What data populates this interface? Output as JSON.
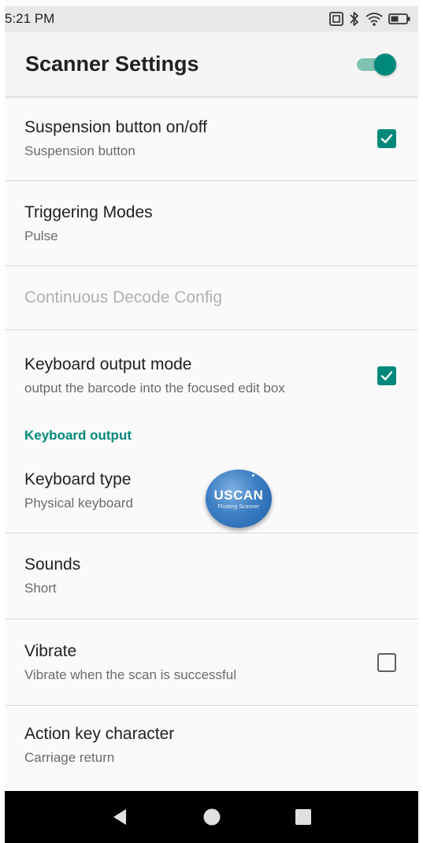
{
  "status_bar": {
    "time": "5:21 PM",
    "icons": [
      "nfc-icon",
      "bluetooth-icon",
      "wifi-icon",
      "battery-icon"
    ]
  },
  "app_bar": {
    "title": "Scanner Settings",
    "master_toggle_on": true,
    "accent_color": "#00897b"
  },
  "prefs": [
    {
      "title": "Suspension button on/off",
      "summary": "Suspension button",
      "widget": "checkbox",
      "checked": true
    },
    {
      "title": "Triggering Modes",
      "summary": "Pulse",
      "widget": "none"
    },
    {
      "title": "Continuous Decode Config",
      "summary": "",
      "widget": "none",
      "disabled": true
    },
    {
      "title": "Keyboard output mode",
      "summary": "output the barcode into the focused edit box",
      "widget": "checkbox",
      "checked": true
    },
    {
      "title": "Keyboard type",
      "summary": "Physical keyboard",
      "widget": "none"
    },
    {
      "title": "Sounds",
      "summary": "Short",
      "widget": "none"
    },
    {
      "title": "Vibrate",
      "summary": "Vibrate when the scan is successful",
      "widget": "checkbox",
      "checked": false
    },
    {
      "title": "Action key character",
      "summary": "Carriage return",
      "widget": "none"
    }
  ],
  "category": {
    "label": "Keyboard output"
  },
  "floating_scanner": {
    "label": "USCAN",
    "sublabel": "Floating Scanner"
  },
  "nav_bar": {
    "buttons": [
      "back-icon",
      "home-icon",
      "recents-icon"
    ]
  }
}
